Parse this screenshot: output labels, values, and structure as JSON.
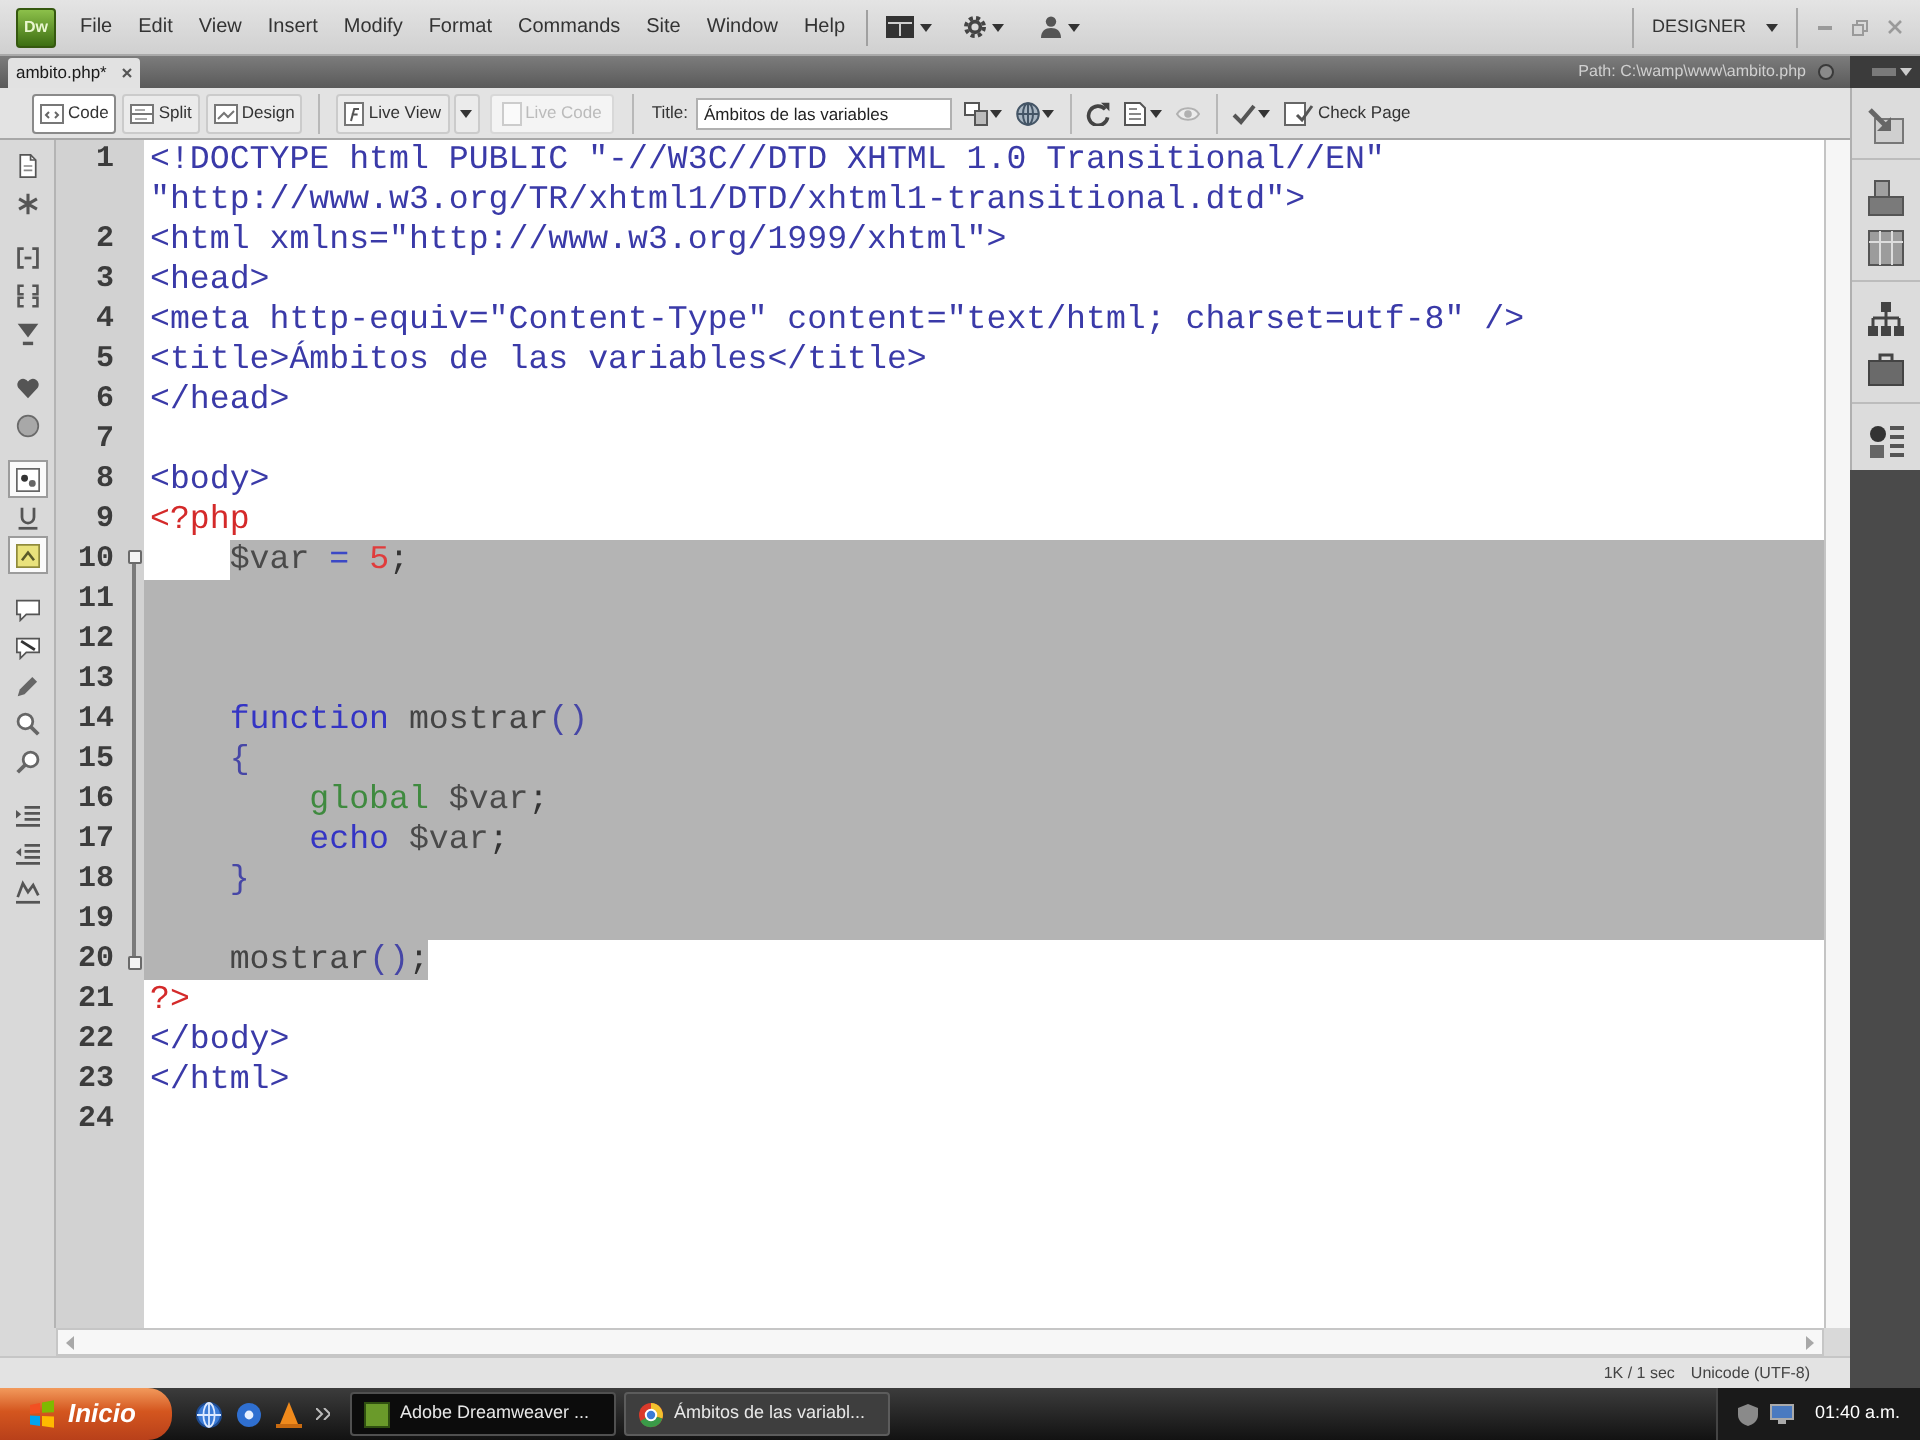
{
  "menu_bar": {
    "logo": "Dw",
    "menus": [
      "File",
      "Edit",
      "View",
      "Insert",
      "Modify",
      "Format",
      "Commands",
      "Site",
      "Window",
      "Help"
    ],
    "workspace": "DESIGNER"
  },
  "document_tabs": {
    "tabs": [
      {
        "label": "ambito.php*",
        "selected": true
      }
    ],
    "path": "Path: C:\\wamp\\www\\ambito.php"
  },
  "document_toolbar": {
    "view_buttons": [
      {
        "kind": "code",
        "label": "Code",
        "selected": true
      },
      {
        "kind": "split",
        "label": "Split",
        "selected": false
      },
      {
        "kind": "design",
        "label": "Design",
        "selected": false
      }
    ],
    "live_view": "Live View",
    "live_code": {
      "label": "Live Code",
      "disabled": true
    },
    "title_label": "Title:",
    "title_value": "Ámbitos de las variables",
    "tool_groups": [
      [
        {
          "kind": "multiscreen",
          "disabled": false
        },
        {
          "kind": "preview",
          "disabled": false
        }
      ],
      [
        {
          "kind": "refresh",
          "disabled": false
        },
        {
          "kind": "view_options",
          "disabled": false
        },
        {
          "kind": "visual_aids",
          "disabled": true
        }
      ],
      [
        {
          "kind": "validate",
          "disabled": false
        }
      ]
    ],
    "check_page": "Check Page"
  },
  "coding_toolbar": [
    [
      {
        "kind": "open_documents",
        "on": false
      },
      {
        "kind": "code_navigator",
        "on": false
      }
    ],
    [
      {
        "kind": "collapse_tag",
        "on": false
      },
      {
        "kind": "collapse_selection",
        "on": false
      },
      {
        "kind": "expand_all",
        "on": false
      }
    ],
    [
      {
        "kind": "select_parent",
        "on": false
      },
      {
        "kind": "balance_braces",
        "on": false
      }
    ],
    [
      {
        "kind": "line_numbers",
        "on": true
      },
      {
        "kind": "highlight_invalid",
        "on": false
      },
      {
        "kind": "syntax_coloring",
        "on": true
      }
    ],
    [
      {
        "kind": "apply_comment",
        "on": false
      },
      {
        "kind": "remove_comment",
        "on": false
      },
      {
        "kind": "wrap_tag",
        "on": false
      },
      {
        "kind": "recent_snippets",
        "on": false
      },
      {
        "kind": "move_css",
        "on": false
      }
    ],
    [
      {
        "kind": "indent",
        "on": false
      },
      {
        "kind": "outdent",
        "on": false
      },
      {
        "kind": "format_source",
        "on": false
      }
    ]
  ],
  "code": {
    "lines": [
      {
        "number": "1",
        "selected": false,
        "tokens": [
          {
            "kind": "tag",
            "text": "<!DOCTYPE html PUBLIC \"-//W3C//DTD XHTML 1.0 Transitional//EN\" \"http://www.w3.org/TR/xhtml1/DTD/xhtml1-transitional.dtd\">"
          }
        ]
      },
      {
        "number": "2",
        "selected": false,
        "tokens": [
          {
            "kind": "tag",
            "text": "<html xmlns=\"http://www.w3.org/1999/xhtml\">"
          }
        ]
      },
      {
        "number": "3",
        "selected": false,
        "tokens": [
          {
            "kind": "tag",
            "text": "<head>"
          }
        ]
      },
      {
        "number": "4",
        "selected": false,
        "tokens": [
          {
            "kind": "tag",
            "text": "<meta http-equiv=\"Content-Type\" content=\"text/html; charset=utf-8\" />"
          }
        ]
      },
      {
        "number": "5",
        "selected": false,
        "tokens": [
          {
            "kind": "tag",
            "text": "<title>Ámbitos de las variables</title>"
          }
        ]
      },
      {
        "number": "6",
        "selected": false,
        "tokens": [
          {
            "kind": "tag",
            "text": "</head>"
          }
        ]
      },
      {
        "number": "7",
        "selected": false
      },
      {
        "number": "8",
        "selected": false,
        "tokens": [
          {
            "kind": "tag",
            "text": "<body>"
          }
        ]
      },
      {
        "number": "9",
        "selected": false,
        "tokens": [
          {
            "kind": "delimiter",
            "text": "<?php"
          }
        ]
      },
      {
        "number": "10",
        "selected": true,
        "selection_starts_at_code": true,
        "tokens": [
          {
            "kind": "variable",
            "text": "    $var"
          },
          {
            "kind": "operator",
            "text": " = "
          },
          {
            "kind": "number",
            "text": "5"
          },
          {
            "kind": "punctuation",
            "text": ";"
          }
        ]
      },
      {
        "number": "11",
        "selected": true
      },
      {
        "number": "12",
        "selected": true
      },
      {
        "number": "13",
        "selected": true
      },
      {
        "number": "14",
        "selected": true,
        "tokens": [
          {
            "kind": "keyword",
            "text": "    function"
          },
          {
            "kind": "identifier",
            "text": " mostrar"
          },
          {
            "kind": "bracket",
            "text": "()"
          }
        ]
      },
      {
        "number": "15",
        "selected": true,
        "tokens": [
          {
            "kind": "bracket",
            "text": "    {"
          }
        ]
      },
      {
        "number": "16",
        "selected": true,
        "tokens": [
          {
            "kind": "builtin",
            "text": "        global"
          },
          {
            "kind": "variable",
            "text": " $var"
          },
          {
            "kind": "punctuation",
            "text": ";"
          }
        ]
      },
      {
        "number": "17",
        "selected": true,
        "tokens": [
          {
            "kind": "keyword",
            "text": "        echo"
          },
          {
            "kind": "variable",
            "text": " $var"
          },
          {
            "kind": "punctuation",
            "text": ";"
          }
        ]
      },
      {
        "number": "18",
        "selected": true,
        "tokens": [
          {
            "kind": "bracket",
            "text": "    }"
          }
        ]
      },
      {
        "number": "19",
        "selected": true
      },
      {
        "number": "20",
        "selected": true,
        "selection_ends_at_code": true,
        "tokens": [
          {
            "kind": "identifier",
            "text": "    mostrar"
          },
          {
            "kind": "bracket",
            "text": "()"
          },
          {
            "kind": "punctuation",
            "text": ";"
          }
        ]
      },
      {
        "number": "21",
        "selected": false,
        "tokens": [
          {
            "kind": "delimiter",
            "text": "?>"
          }
        ]
      },
      {
        "number": "22",
        "selected": false,
        "tokens": [
          {
            "kind": "tag",
            "text": "</body>"
          }
        ]
      },
      {
        "number": "23",
        "selected": false,
        "tokens": [
          {
            "kind": "tag",
            "text": "</html>"
          }
        ]
      },
      {
        "number": "24",
        "selected": false
      }
    ]
  },
  "status_bar": {
    "size_time": "1K / 1 sec",
    "encoding": "Unicode (UTF-8)"
  },
  "taskbar": {
    "start": "Inicio",
    "tasks": [
      {
        "kind": "editor",
        "label": "Adobe Dreamweaver ...",
        "selected": true
      },
      {
        "kind": "browser",
        "label": "Ámbitos de las variabl...",
        "selected": false
      }
    ],
    "clock": "01:40 a.m."
  }
}
